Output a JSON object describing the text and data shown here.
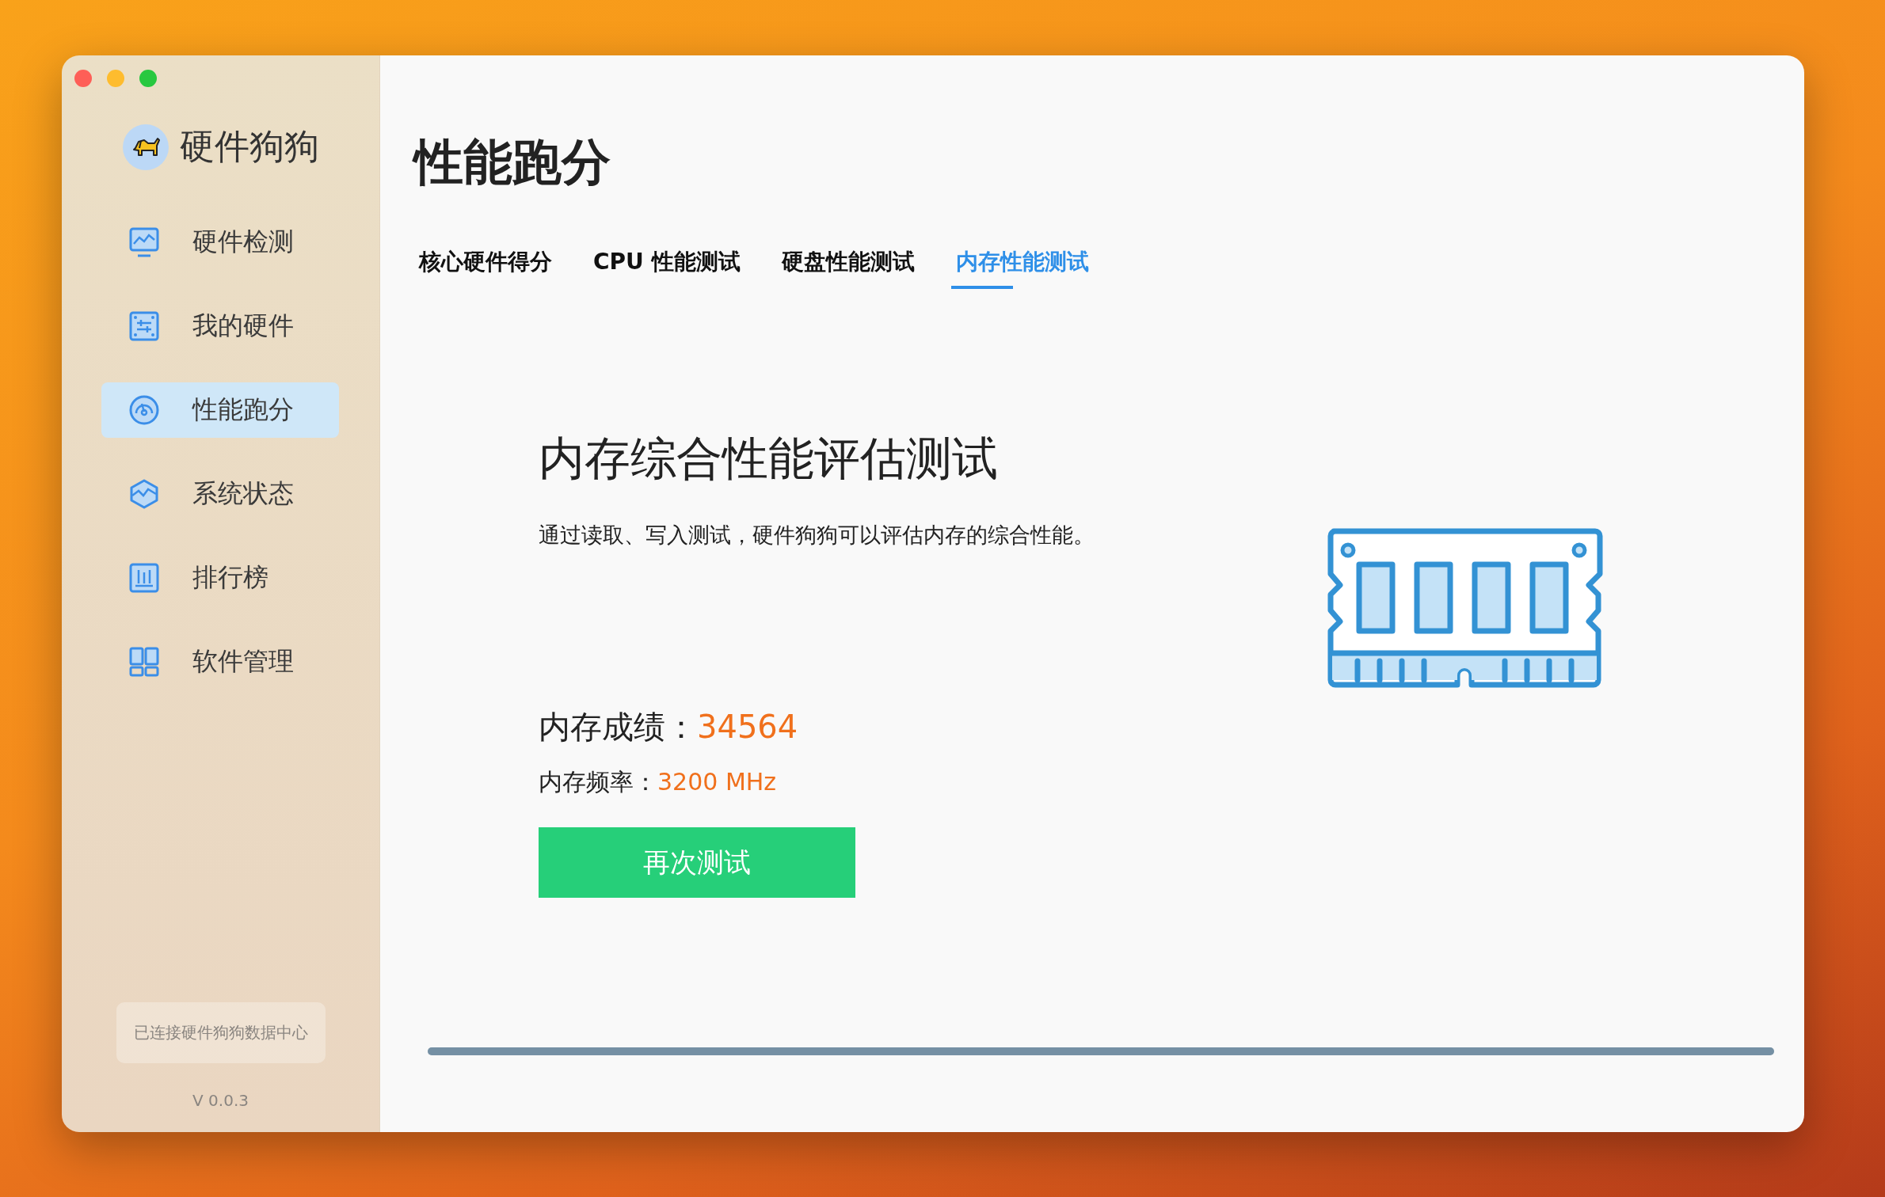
{
  "sidebar": {
    "app_name": "硬件狗狗",
    "items": [
      {
        "label": "硬件检测",
        "kind": "monitor",
        "selected": false
      },
      {
        "label": "我的硬件",
        "kind": "board",
        "selected": false
      },
      {
        "label": "性能跑分",
        "kind": "gauge",
        "selected": true
      },
      {
        "label": "系统状态",
        "kind": "hexagon",
        "selected": false
      },
      {
        "label": "排行榜",
        "kind": "chart",
        "selected": false
      },
      {
        "label": "软件管理",
        "kind": "grid",
        "selected": false
      }
    ],
    "status": "已连接硬件狗狗数据中心",
    "version": "V 0.0.3"
  },
  "page": {
    "title": "性能跑分",
    "tabs": [
      {
        "label": "核心硬件得分",
        "selected": false
      },
      {
        "label": "CPU 性能测试",
        "selected": false
      },
      {
        "label": "硬盘性能测试",
        "selected": false
      },
      {
        "label": "内存性能测试",
        "selected": true
      }
    ],
    "section_title": "内存综合性能评估测试",
    "description": "通过读取、写入测试，硬件狗狗可以评估内存的综合性能。",
    "score": {
      "label": "内存成绩：",
      "value": "34564"
    },
    "frequency": {
      "label": "内存频率：",
      "value": "3200 MHz"
    },
    "retest_button": "再次测试",
    "progress": {
      "level": 1
    }
  }
}
